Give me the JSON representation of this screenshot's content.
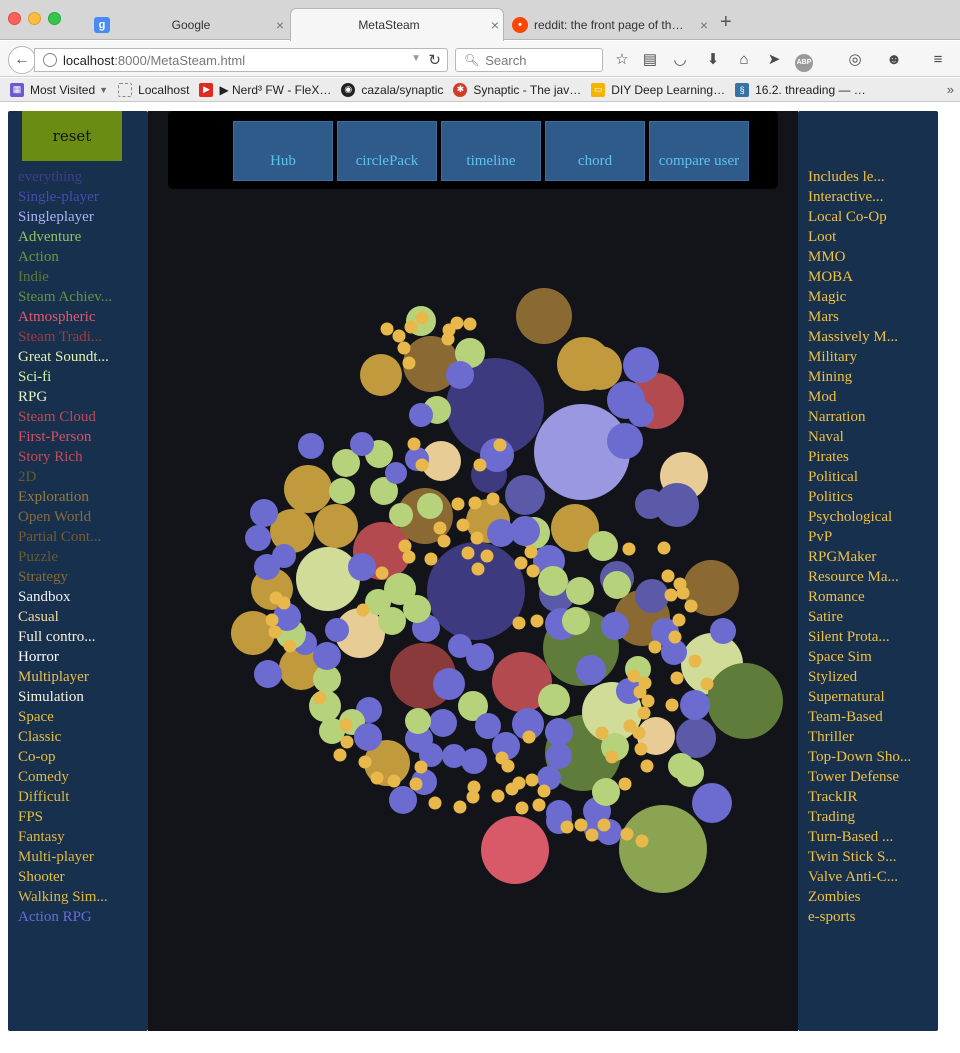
{
  "browser": {
    "tabs": [
      {
        "title": "Google",
        "favicon": "google-icon"
      },
      {
        "title": "MetaSteam",
        "favicon": ""
      },
      {
        "title": "reddit: the front page of the …",
        "favicon": "reddit-icon"
      }
    ],
    "url": {
      "host": "localhost",
      "rest": ":8000/MetaSteam.html"
    },
    "search_placeholder": "Search",
    "bookmarks": [
      {
        "label": "Most Visited",
        "icon": "most-visited-icon",
        "color": "#6a5acd"
      },
      {
        "label": "Localhost",
        "icon": "page-icon",
        "color": "#999999"
      },
      {
        "label": "▶ Nerd³ FW - FleX…",
        "icon": "youtube-icon",
        "color": "#e02a20"
      },
      {
        "label": "cazala/synaptic",
        "icon": "github-icon",
        "color": "#222222"
      },
      {
        "label": "Synaptic - The jav…",
        "icon": "synaptic-icon",
        "color": "#d23a2a"
      },
      {
        "label": "DIY Deep Learning…",
        "icon": "slides-icon",
        "color": "#f4b400"
      },
      {
        "label": "16.2. threading — …",
        "icon": "python-icon",
        "color": "#3572a5"
      }
    ]
  },
  "controls": {
    "reset_label": "reset"
  },
  "nav_buttons": [
    "Hub",
    "circlePack",
    "timeline",
    "chord",
    "compare user"
  ],
  "left_tags": [
    {
      "label": "everything",
      "color": "#3f3d8a"
    },
    {
      "label": "Single-player",
      "color": "#4a4ab0"
    },
    {
      "label": "Singleplayer",
      "color": "#b0b0f0"
    },
    {
      "label": "Adventure",
      "color": "#94c060"
    },
    {
      "label": "Action",
      "color": "#6a9a3a"
    },
    {
      "label": "Indie",
      "color": "#5a7a3a"
    },
    {
      "label": "Steam Achiev...",
      "color": "#6a9040"
    },
    {
      "label": "Atmospheric",
      "color": "#e05a6a"
    },
    {
      "label": "Steam Tradi...",
      "color": "#a03a40"
    },
    {
      "label": "Great Soundt...",
      "color": "#e6f0b0"
    },
    {
      "label": "Sci-fi",
      "color": "#d8f0a0"
    },
    {
      "label": "RPG",
      "color": "#e8f4c0"
    },
    {
      "label": "Steam Cloud",
      "color": "#c04a55"
    },
    {
      "label": "First-Person",
      "color": "#d85060"
    },
    {
      "label": "Story Rich",
      "color": "#c84a55"
    },
    {
      "label": "2D",
      "color": "#6a5a2a"
    },
    {
      "label": "Exploration",
      "color": "#9a7a3a"
    },
    {
      "label": "Open World",
      "color": "#8a6a3a"
    },
    {
      "label": "Partial Cont...",
      "color": "#7a5a2a"
    },
    {
      "label": "Puzzle",
      "color": "#6a5a30"
    },
    {
      "label": "Strategy",
      "color": "#8a6a30"
    },
    {
      "label": "Sandbox",
      "color": "#f0f0f0"
    },
    {
      "label": "Casual",
      "color": "#f0d8a0"
    },
    {
      "label": "Full contro...",
      "color": "#f8f0e0"
    },
    {
      "label": "Horror",
      "color": "#ffffff"
    },
    {
      "label": "Multiplayer",
      "color": "#e8c050"
    },
    {
      "label": "Simulation",
      "color": "#f4f4e0"
    },
    {
      "label": "Space",
      "color": "#e8c040"
    },
    {
      "label": "Classic",
      "color": "#e8c040"
    },
    {
      "label": "Co-op",
      "color": "#e8c040"
    },
    {
      "label": "Comedy",
      "color": "#e0b840"
    },
    {
      "label": "Difficult",
      "color": "#e0b840"
    },
    {
      "label": "FPS",
      "color": "#e8c040"
    },
    {
      "label": "Fantasy",
      "color": "#e0b840"
    },
    {
      "label": "Multi-player",
      "color": "#e0b840"
    },
    {
      "label": "Shooter",
      "color": "#e8c040"
    },
    {
      "label": "Walking Sim...",
      "color": "#e0b840"
    },
    {
      "label": "Action RPG",
      "color": "#6a6adc"
    }
  ],
  "right_tags": [
    "Includes le...",
    "Interactive...",
    "Local Co-Op",
    "Loot",
    "MMO",
    "MOBA",
    "Magic",
    "Mars",
    "Massively M...",
    "Military",
    "Mining",
    "Mod",
    "Narration",
    "Naval",
    "Pirates",
    "Political",
    "Politics",
    "Psychological",
    "PvP",
    "RPGMaker",
    "Resource Ma...",
    "Romance",
    "Satire",
    "Silent Prota...",
    "Space Sim",
    "Stylized",
    "Supernatural",
    "Team-Based",
    "Thriller",
    "Top-Down Sho...",
    "Tower Defense",
    "TrackIR",
    "Trading",
    "Turn-Based ...",
    "Twin Stick S...",
    "Valve Anti-C...",
    "Zombies",
    "e-sports"
  ],
  "colors": {
    "panel_bg": "#16304e",
    "canvas_bg": "#13141a",
    "reset_bg": "#6a8c12",
    "nav_button_bg": "#2f5b8a",
    "nav_button_text": "#5dc2f0",
    "right_tag_text": "#f0c040"
  }
}
